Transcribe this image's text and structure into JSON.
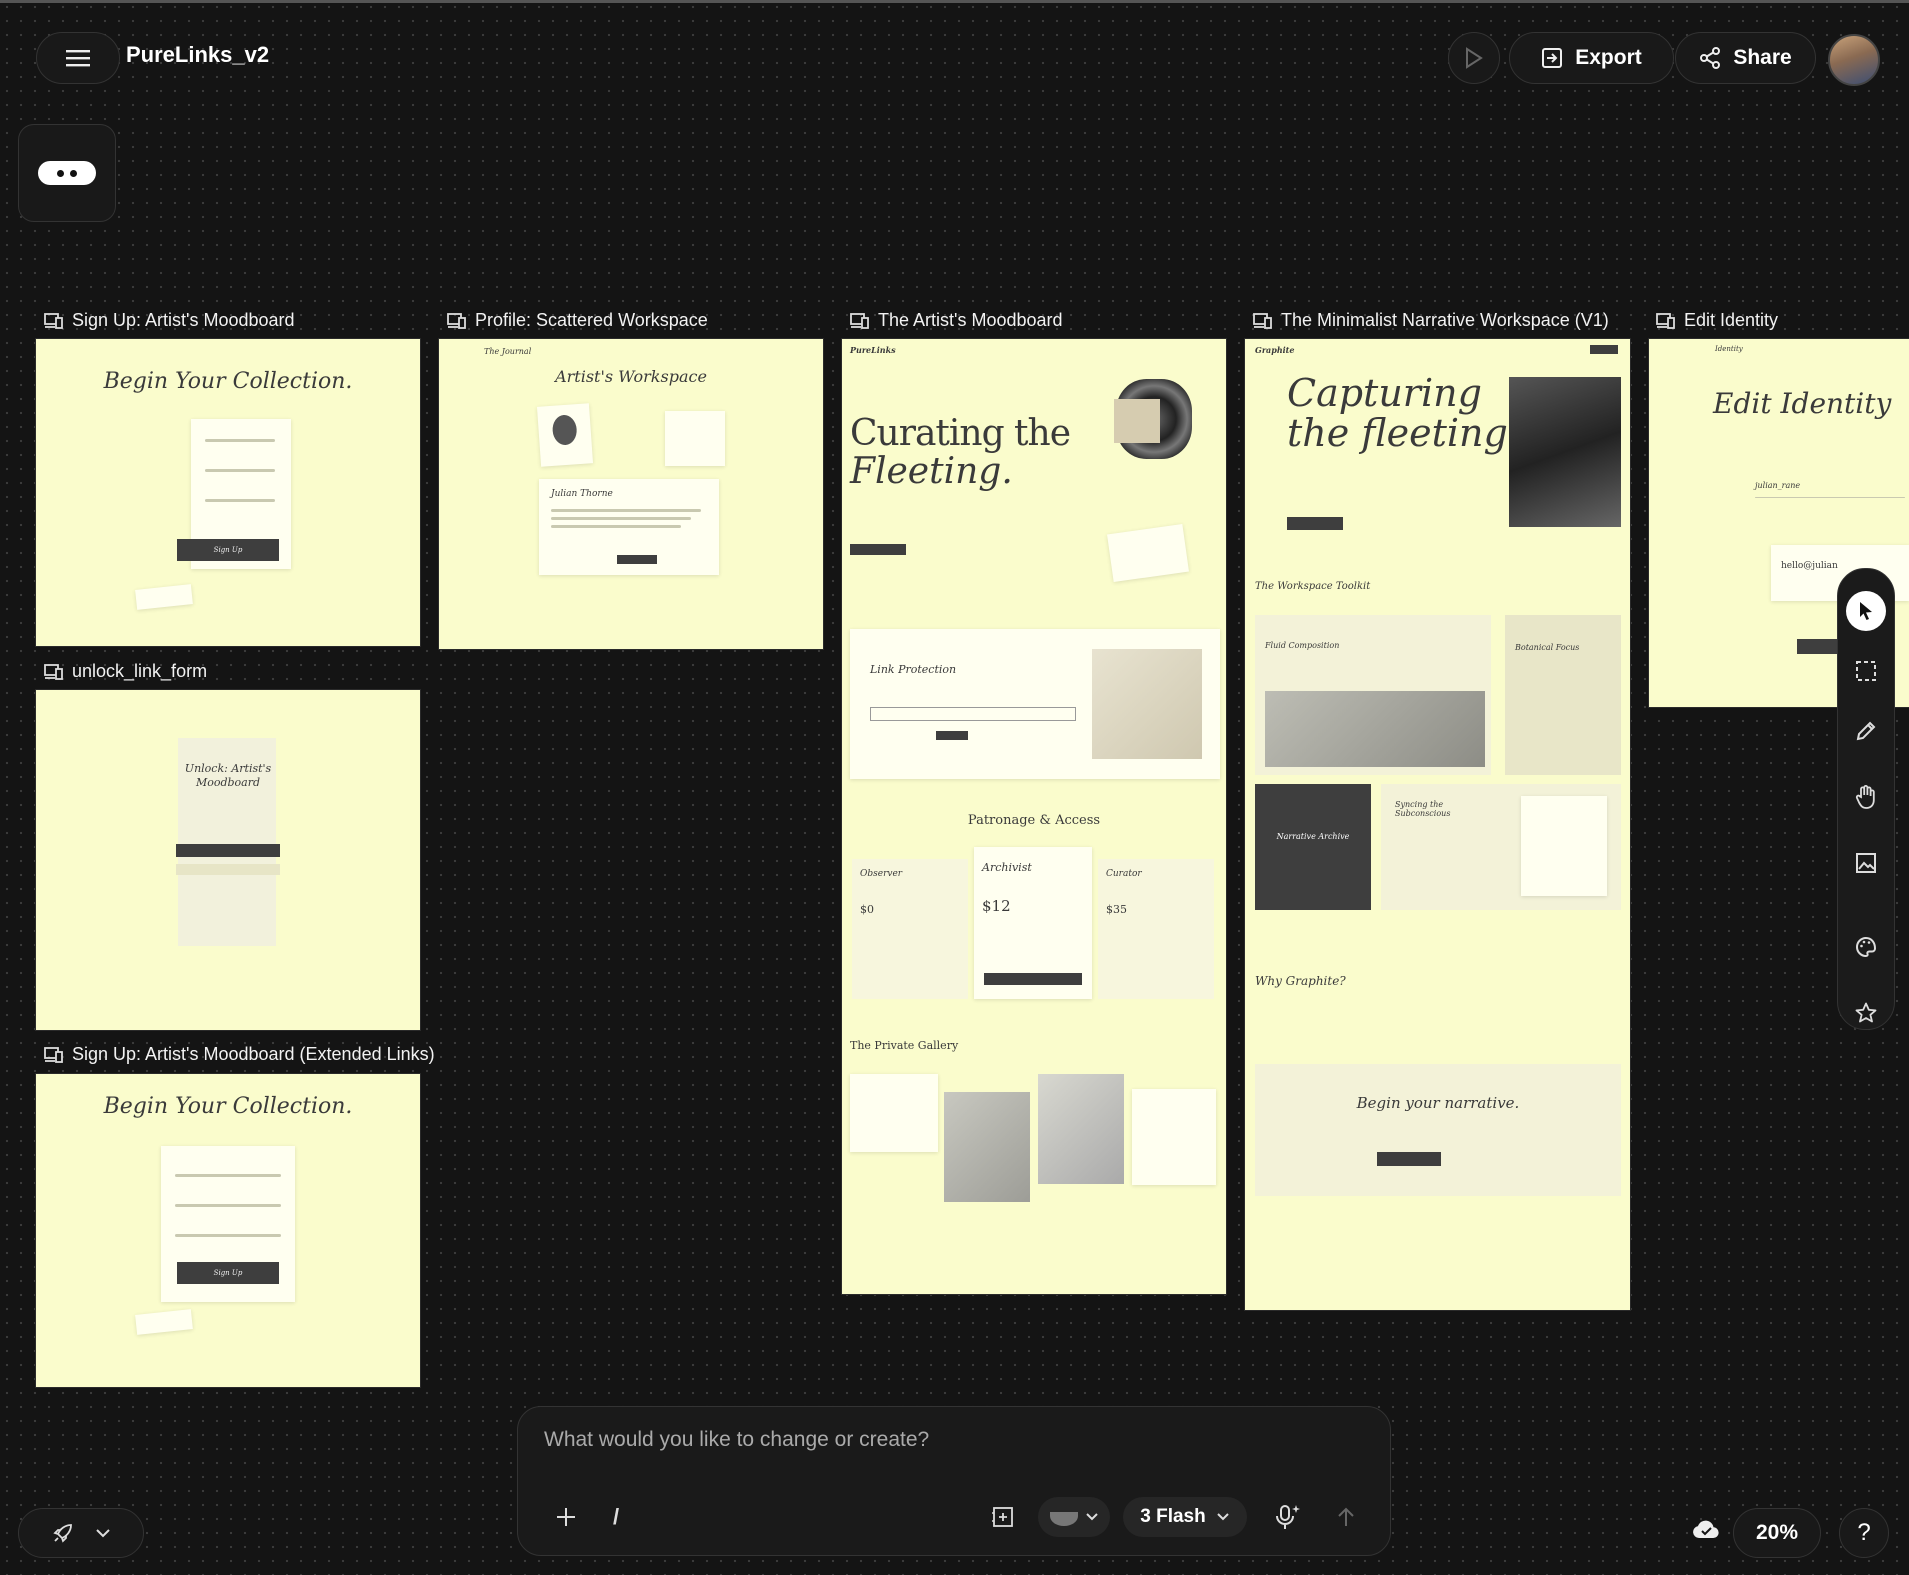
{
  "header": {
    "title": "PureLinks_v2",
    "export_label": "Export",
    "share_label": "Share"
  },
  "frames": [
    {
      "label": "Sign Up: Artist's Moodboard",
      "heading": "Begin Your Collection.",
      "button": "Sign Up"
    },
    {
      "label": "Profile: Scattered Workspace",
      "brand": "The Journal",
      "heading": "Artist's Workspace",
      "name": "Julian Thorne"
    },
    {
      "label": "The Artist's Moodboard",
      "brand": "PureLinks",
      "heading_line1": "Curating the",
      "heading_line2": "Fleeting.",
      "section_link": "Link Protection",
      "section_pricing": "Patronage & Access",
      "tiers": [
        {
          "name": "Observer",
          "price": "$0"
        },
        {
          "name": "Archivist",
          "price": "$12"
        },
        {
          "name": "Curator",
          "price": "$35"
        }
      ],
      "section_gallery": "The Private Gallery"
    },
    {
      "label": "The Minimalist Narrative Workspace (V1)",
      "brand": "Graphite",
      "heading_line1": "Capturing",
      "heading_line2": "the fleeting",
      "toolkit": "The Workspace Toolkit",
      "card1": "Fluid Composition",
      "card2": "Botanical Focus",
      "card3": "Narrative Archive",
      "card4": "Syncing the Subconscious",
      "why": "Why Graphite?",
      "cta": "Begin your narrative."
    },
    {
      "label": "Edit Identity",
      "brand": "Identity",
      "heading": "Edit Identity",
      "field_value": "julian_rane",
      "email_value": "hello@julian"
    },
    {
      "label": "unlock_link_form",
      "heading_line1": "Unlock: Artist's",
      "heading_line2": "Moodboard"
    },
    {
      "label": "Sign Up: Artist's Moodboard (Extended Links)",
      "heading": "Begin Your Collection.",
      "button": "Sign Up"
    }
  ],
  "chat": {
    "placeholder": "What would you like to change or create?",
    "slash": "/",
    "model": "3 Flash"
  },
  "footer": {
    "zoom": "20%",
    "help": "?"
  }
}
